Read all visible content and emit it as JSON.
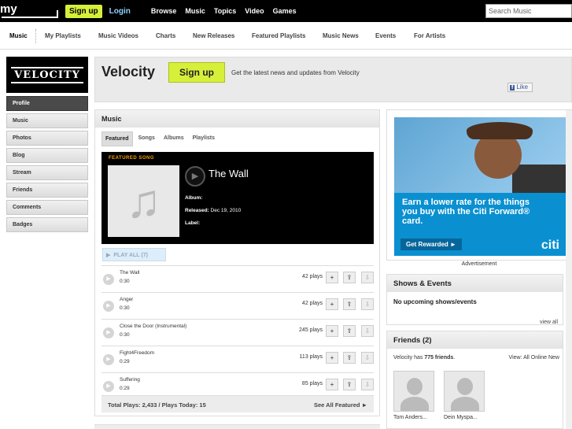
{
  "top": {
    "logo": "my",
    "signup": "Sign up",
    "login": "Login",
    "nav": [
      "Browse",
      "Music",
      "Topics",
      "Video",
      "Games"
    ],
    "search_placeholder": "Search Music"
  },
  "subnav": [
    "Music",
    "My Playlists",
    "Music Videos",
    "Charts",
    "New Releases",
    "Featured Playlists",
    "Music News",
    "Events",
    "For Artists"
  ],
  "artist": {
    "logo_text": "VELOCITY",
    "name": "Velocity",
    "signup": "Sign up",
    "tagline": "Get the latest news and updates from Velocity",
    "like": "Like",
    "like_icon": "f"
  },
  "leftnav": [
    "Profile",
    "Music",
    "Photos",
    "Blog",
    "Stream",
    "Friends",
    "Comments",
    "Badges"
  ],
  "music": {
    "heading": "Music",
    "tabs": [
      "Featured",
      "Songs",
      "Albums",
      "Playlists"
    ],
    "featured": {
      "label": "FEATURED SONG",
      "title": "The Wall",
      "album_label": "Album:",
      "released_label": "Released:",
      "released_value": "Dec 19, 2010",
      "label_label": "Label:"
    },
    "play_all": "PLAY ALL (7)",
    "tracks": [
      {
        "name": "The Wall",
        "duration": "0:30",
        "plays": "42 plays"
      },
      {
        "name": "Anger",
        "duration": "0:30",
        "plays": "42 plays"
      },
      {
        "name": "Close the Door (Instrumental)",
        "duration": "0:30",
        "plays": "245 plays"
      },
      {
        "name": "Fight4Freedom",
        "duration": "0:29",
        "plays": "113 plays"
      },
      {
        "name": "Suffering",
        "duration": "0:29",
        "plays": "85 plays"
      }
    ],
    "totals": "Total Plays: 2,433 / Plays Today: 15",
    "see_all": "See All Featured ►"
  },
  "ad": {
    "headline": "Earn a lower rate for the things you buy with the Citi Forward® card.",
    "button": "Get Rewarded ►",
    "brand": "citi",
    "label": "Advertisement"
  },
  "shows": {
    "heading": "Shows & Events",
    "message": "No upcoming shows/events",
    "view_all": "view all"
  },
  "friends": {
    "heading": "Friends (2)",
    "count_prefix": "Velocity has ",
    "count_num": "775 friends",
    "count_suffix": ".",
    "view": "View:  All  Online  New",
    "list": [
      "Tom Anders...",
      "Dein Myspa..."
    ]
  }
}
